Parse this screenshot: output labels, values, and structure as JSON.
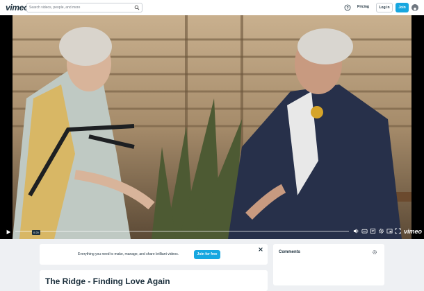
{
  "header": {
    "logo": "vimeo",
    "search_placeholder": "Search videos, people, and more",
    "pricing": "Pricing",
    "login": "Log in",
    "join": "Join"
  },
  "player": {
    "time": "0:20",
    "progress_fraction": 0.0,
    "brand": "vimeo"
  },
  "banner": {
    "text": "Everything you need to make, manage, and share brilliant videos.",
    "button": "Join for free"
  },
  "comments": {
    "title": "Comments"
  },
  "video": {
    "title": "The Ridge - Finding Love Again"
  },
  "colors": {
    "accent": "#17a7e0",
    "text_dark": "#1a2e3b",
    "page_bg": "#eef0f3"
  }
}
